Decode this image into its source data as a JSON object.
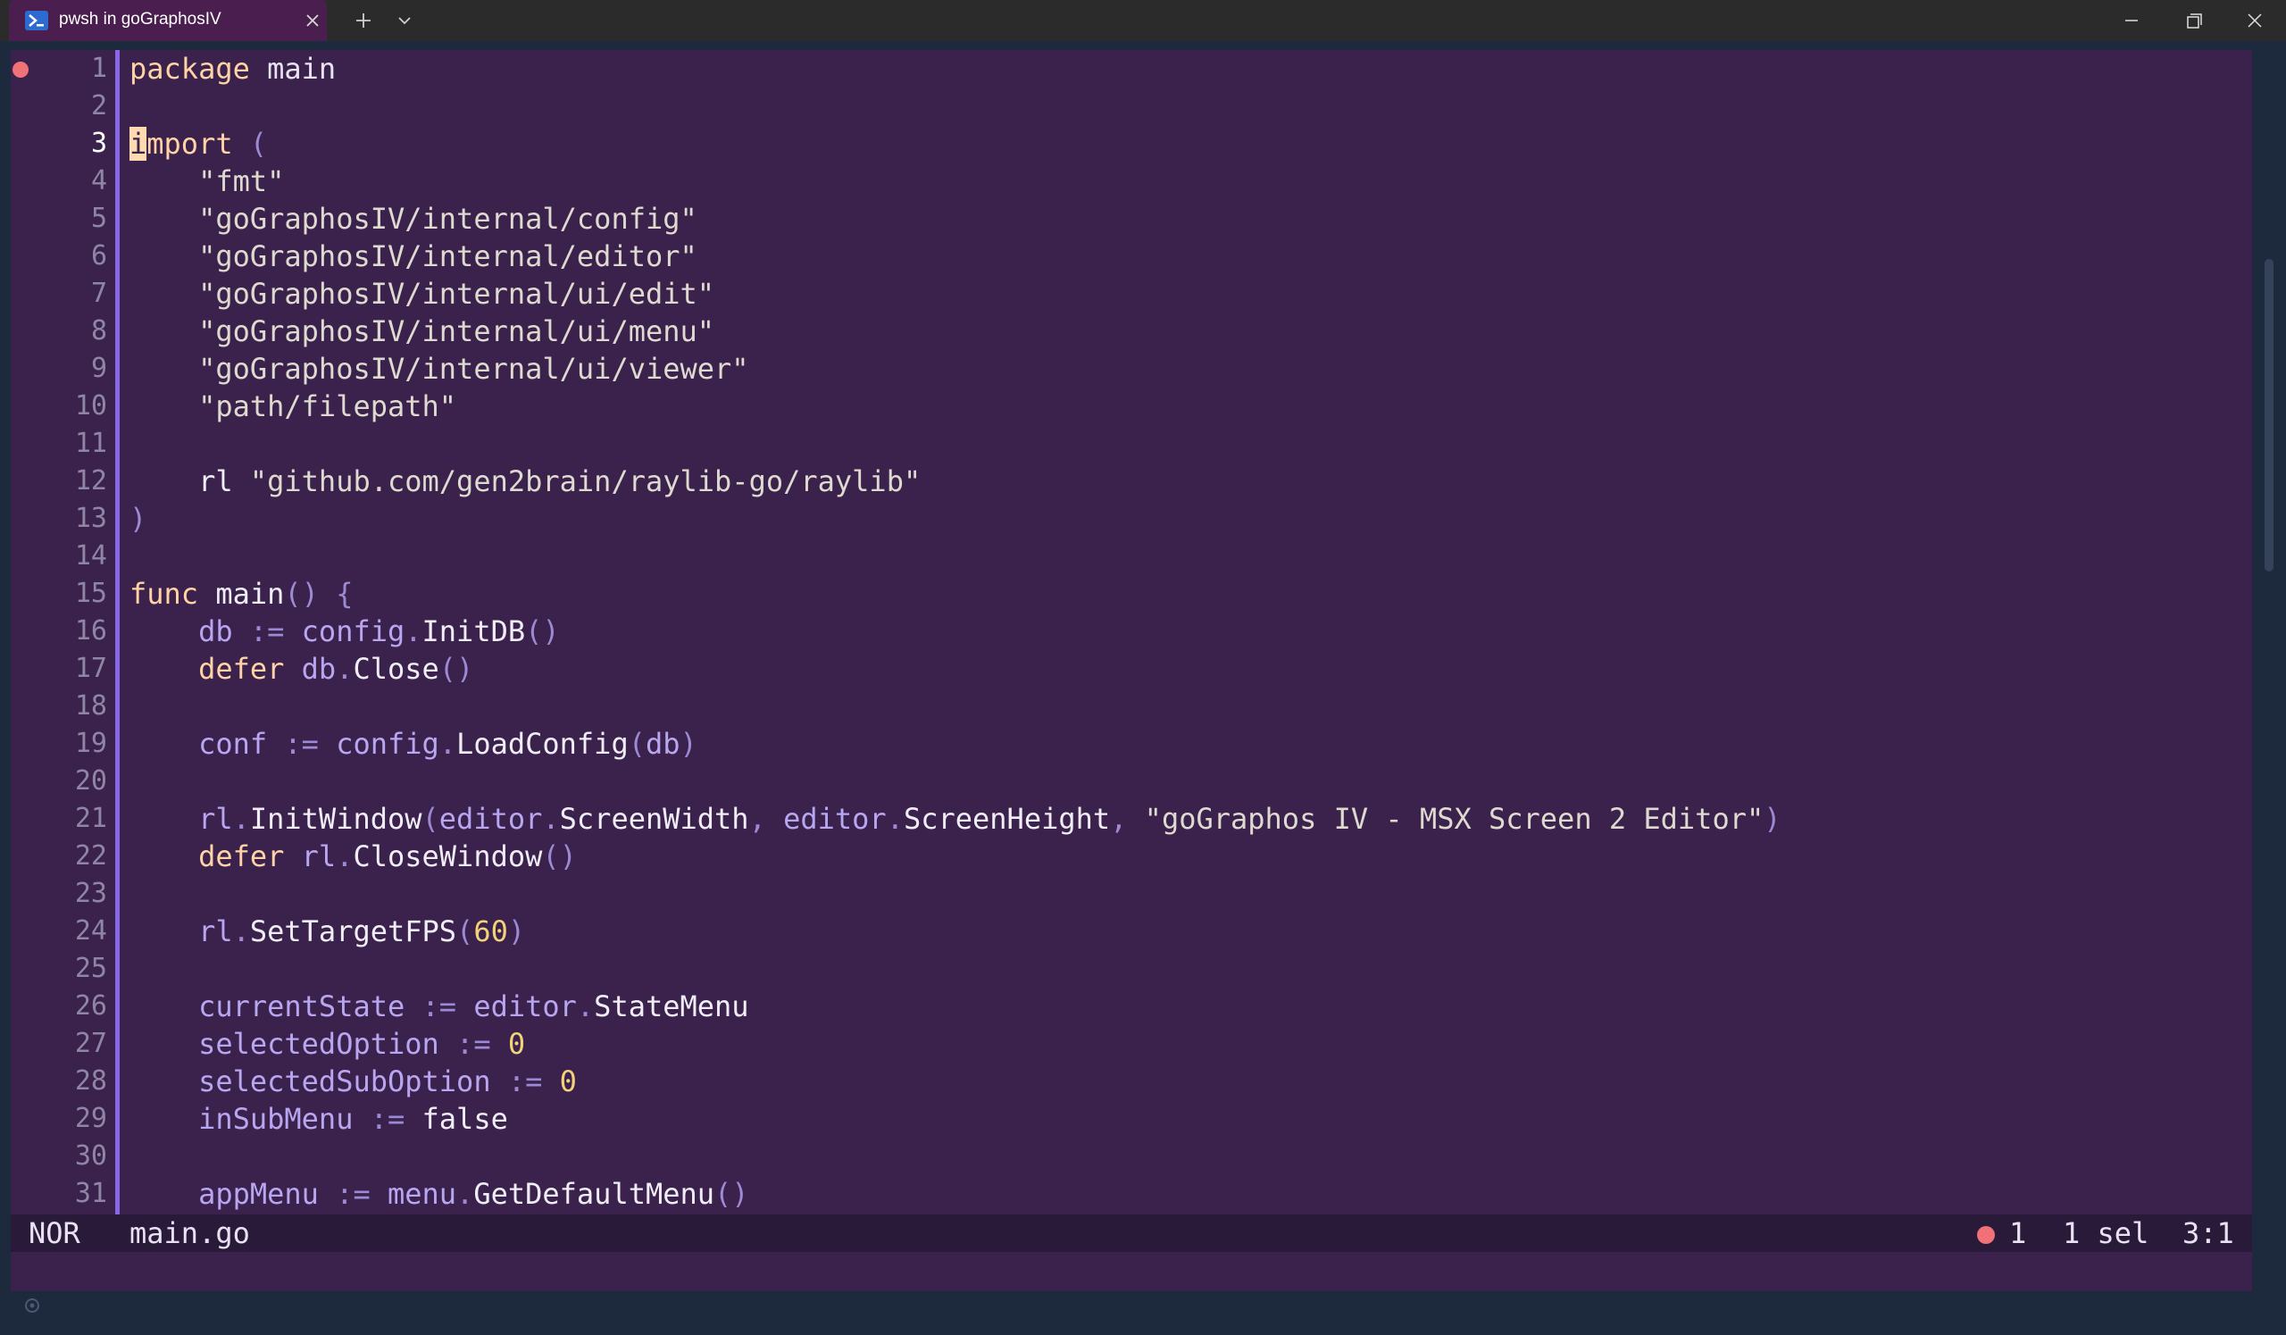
{
  "window": {
    "tab_title": "pwsh in goGraphosIV"
  },
  "editor": {
    "current_line": 3,
    "lines": [
      {
        "n": "1",
        "parts": [
          {
            "c": "kw",
            "t": "package"
          },
          {
            "c": "plain",
            "t": " main"
          }
        ]
      },
      {
        "n": "2",
        "parts": []
      },
      {
        "n": "3",
        "parts": [
          {
            "c": "cursor",
            "t": "i"
          },
          {
            "c": "kw",
            "t": "mport"
          },
          {
            "c": "plain",
            "t": " "
          },
          {
            "c": "pun",
            "t": "("
          }
        ]
      },
      {
        "n": "4",
        "parts": [
          {
            "c": "plain",
            "t": "    "
          },
          {
            "c": "str",
            "t": "\"fmt\""
          }
        ]
      },
      {
        "n": "5",
        "parts": [
          {
            "c": "plain",
            "t": "    "
          },
          {
            "c": "str",
            "t": "\"goGraphosIV/internal/config\""
          }
        ]
      },
      {
        "n": "6",
        "parts": [
          {
            "c": "plain",
            "t": "    "
          },
          {
            "c": "str",
            "t": "\"goGraphosIV/internal/editor\""
          }
        ]
      },
      {
        "n": "7",
        "parts": [
          {
            "c": "plain",
            "t": "    "
          },
          {
            "c": "str",
            "t": "\"goGraphosIV/internal/ui/edit\""
          }
        ]
      },
      {
        "n": "8",
        "parts": [
          {
            "c": "plain",
            "t": "    "
          },
          {
            "c": "str",
            "t": "\"goGraphosIV/internal/ui/menu\""
          }
        ]
      },
      {
        "n": "9",
        "parts": [
          {
            "c": "plain",
            "t": "    "
          },
          {
            "c": "str",
            "t": "\"goGraphosIV/internal/ui/viewer\""
          }
        ]
      },
      {
        "n": "10",
        "parts": [
          {
            "c": "plain",
            "t": "    "
          },
          {
            "c": "str",
            "t": "\"path/filepath\""
          }
        ]
      },
      {
        "n": "11",
        "parts": []
      },
      {
        "n": "12",
        "parts": [
          {
            "c": "plain",
            "t": "    "
          },
          {
            "c": "fn",
            "t": "rl "
          },
          {
            "c": "str",
            "t": "\"github.com/gen2brain/raylib-go/raylib\""
          }
        ]
      },
      {
        "n": "13",
        "parts": [
          {
            "c": "pun",
            "t": ")"
          }
        ]
      },
      {
        "n": "14",
        "parts": []
      },
      {
        "n": "15",
        "parts": [
          {
            "c": "kw",
            "t": "func"
          },
          {
            "c": "plain",
            "t": " "
          },
          {
            "c": "fn",
            "t": "main"
          },
          {
            "c": "pun",
            "t": "() {"
          }
        ]
      },
      {
        "n": "16",
        "parts": [
          {
            "c": "plain",
            "t": "    "
          },
          {
            "c": "id",
            "t": "db"
          },
          {
            "c": "pun",
            "t": " := "
          },
          {
            "c": "id",
            "t": "config"
          },
          {
            "c": "pun",
            "t": "."
          },
          {
            "c": "fn",
            "t": "InitDB"
          },
          {
            "c": "pun",
            "t": "()"
          }
        ]
      },
      {
        "n": "17",
        "parts": [
          {
            "c": "plain",
            "t": "    "
          },
          {
            "c": "def",
            "t": "defer"
          },
          {
            "c": "plain",
            "t": " "
          },
          {
            "c": "id",
            "t": "db"
          },
          {
            "c": "pun",
            "t": "."
          },
          {
            "c": "fn",
            "t": "Close"
          },
          {
            "c": "pun",
            "t": "()"
          }
        ]
      },
      {
        "n": "18",
        "parts": []
      },
      {
        "n": "19",
        "parts": [
          {
            "c": "plain",
            "t": "    "
          },
          {
            "c": "id",
            "t": "conf"
          },
          {
            "c": "pun",
            "t": " := "
          },
          {
            "c": "id",
            "t": "config"
          },
          {
            "c": "pun",
            "t": "."
          },
          {
            "c": "fn",
            "t": "LoadConfig"
          },
          {
            "c": "pun",
            "t": "("
          },
          {
            "c": "id",
            "t": "db"
          },
          {
            "c": "pun",
            "t": ")"
          }
        ]
      },
      {
        "n": "20",
        "parts": []
      },
      {
        "n": "21",
        "parts": [
          {
            "c": "plain",
            "t": "    "
          },
          {
            "c": "id",
            "t": "rl"
          },
          {
            "c": "pun",
            "t": "."
          },
          {
            "c": "fn",
            "t": "InitWindow"
          },
          {
            "c": "pun",
            "t": "("
          },
          {
            "c": "id",
            "t": "editor"
          },
          {
            "c": "pun",
            "t": "."
          },
          {
            "c": "fn",
            "t": "ScreenWidth"
          },
          {
            "c": "pun",
            "t": ", "
          },
          {
            "c": "id",
            "t": "editor"
          },
          {
            "c": "pun",
            "t": "."
          },
          {
            "c": "fn",
            "t": "ScreenHeight"
          },
          {
            "c": "pun",
            "t": ", "
          },
          {
            "c": "str",
            "t": "\"goGraphos IV - MSX Screen 2 Editor\""
          },
          {
            "c": "pun",
            "t": ")"
          }
        ]
      },
      {
        "n": "22",
        "parts": [
          {
            "c": "plain",
            "t": "    "
          },
          {
            "c": "def",
            "t": "defer"
          },
          {
            "c": "plain",
            "t": " "
          },
          {
            "c": "id",
            "t": "rl"
          },
          {
            "c": "pun",
            "t": "."
          },
          {
            "c": "fn",
            "t": "CloseWindow"
          },
          {
            "c": "pun",
            "t": "()"
          }
        ]
      },
      {
        "n": "23",
        "parts": []
      },
      {
        "n": "24",
        "parts": [
          {
            "c": "plain",
            "t": "    "
          },
          {
            "c": "id",
            "t": "rl"
          },
          {
            "c": "pun",
            "t": "."
          },
          {
            "c": "fn",
            "t": "SetTargetFPS"
          },
          {
            "c": "pun",
            "t": "("
          },
          {
            "c": "num",
            "t": "60"
          },
          {
            "c": "pun",
            "t": ")"
          }
        ]
      },
      {
        "n": "25",
        "parts": []
      },
      {
        "n": "26",
        "parts": [
          {
            "c": "plain",
            "t": "    "
          },
          {
            "c": "id",
            "t": "currentState"
          },
          {
            "c": "pun",
            "t": " := "
          },
          {
            "c": "id",
            "t": "editor"
          },
          {
            "c": "pun",
            "t": "."
          },
          {
            "c": "fn",
            "t": "StateMenu"
          }
        ]
      },
      {
        "n": "27",
        "parts": [
          {
            "c": "plain",
            "t": "    "
          },
          {
            "c": "id",
            "t": "selectedOption"
          },
          {
            "c": "pun",
            "t": " := "
          },
          {
            "c": "num",
            "t": "0"
          }
        ]
      },
      {
        "n": "28",
        "parts": [
          {
            "c": "plain",
            "t": "    "
          },
          {
            "c": "id",
            "t": "selectedSubOption"
          },
          {
            "c": "pun",
            "t": " := "
          },
          {
            "c": "num",
            "t": "0"
          }
        ]
      },
      {
        "n": "29",
        "parts": [
          {
            "c": "plain",
            "t": "    "
          },
          {
            "c": "id",
            "t": "inSubMenu"
          },
          {
            "c": "pun",
            "t": " := "
          },
          {
            "c": "fn",
            "t": "false"
          }
        ]
      },
      {
        "n": "30",
        "parts": []
      },
      {
        "n": "31",
        "parts": [
          {
            "c": "plain",
            "t": "    "
          },
          {
            "c": "id",
            "t": "appMenu"
          },
          {
            "c": "pun",
            "t": " := "
          },
          {
            "c": "id",
            "t": "menu"
          },
          {
            "c": "pun",
            "t": "."
          },
          {
            "c": "fn",
            "t": "GetDefaultMenu"
          },
          {
            "c": "pun",
            "t": "()"
          }
        ]
      }
    ]
  },
  "status": {
    "mode": "NOR",
    "filename": "main.go",
    "diagnostics": "1",
    "selections": "1 sel",
    "position": "3:1"
  },
  "colors": {
    "background": "#3b224c",
    "tab": "#4a1f4f",
    "accent": "#8a67e6",
    "error": "#f07178"
  }
}
